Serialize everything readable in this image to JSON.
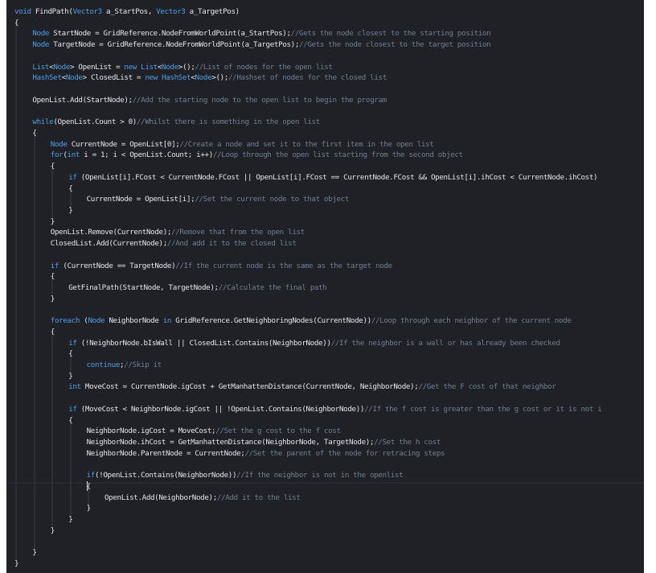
{
  "code": {
    "lines": [
      {
        "indent": 0,
        "tokens": [
          [
            "kw",
            "void"
          ],
          [
            "tx",
            " FindPath("
          ],
          [
            "ty",
            "Vector3"
          ],
          [
            "tx",
            " a_StartPos, "
          ],
          [
            "ty",
            "Vector3"
          ],
          [
            "tx",
            " a_TargetPos)"
          ]
        ]
      },
      {
        "indent": 0,
        "tokens": [
          [
            "tx",
            "{"
          ]
        ]
      },
      {
        "indent": 1,
        "tokens": [
          [
            "ty",
            "Node"
          ],
          [
            "tx",
            " StartNode = GridReference.NodeFromWorldPoint(a_StartPos);"
          ],
          [
            "cm",
            "//Gets the node closest to the starting position"
          ]
        ]
      },
      {
        "indent": 1,
        "tokens": [
          [
            "ty",
            "Node"
          ],
          [
            "tx",
            " TargetNode = GridReference.NodeFromWorldPoint(a_TargetPos);"
          ],
          [
            "cm",
            "//Gets the node closest to the target position"
          ]
        ]
      },
      {
        "indent": 0,
        "tokens": []
      },
      {
        "indent": 1,
        "tokens": [
          [
            "ty",
            "List"
          ],
          [
            "tx",
            "<"
          ],
          [
            "ty",
            "Node"
          ],
          [
            "tx",
            "> OpenList = "
          ],
          [
            "kw",
            "new"
          ],
          [
            "tx",
            " "
          ],
          [
            "ty",
            "List"
          ],
          [
            "tx",
            "<"
          ],
          [
            "ty",
            "Node"
          ],
          [
            "tx",
            ">();"
          ],
          [
            "cm",
            "//List of nodes for the open list"
          ]
        ]
      },
      {
        "indent": 1,
        "tokens": [
          [
            "ty",
            "HashSet"
          ],
          [
            "tx",
            "<"
          ],
          [
            "ty",
            "Node"
          ],
          [
            "tx",
            "> ClosedList = "
          ],
          [
            "kw",
            "new"
          ],
          [
            "tx",
            " "
          ],
          [
            "ty",
            "HashSet"
          ],
          [
            "tx",
            "<"
          ],
          [
            "ty",
            "Node"
          ],
          [
            "tx",
            ">();"
          ],
          [
            "cm",
            "//Hashset of nodes for the closed list"
          ]
        ]
      },
      {
        "indent": 0,
        "tokens": []
      },
      {
        "indent": 1,
        "tokens": [
          [
            "tx",
            "OpenList.Add(StartNode);"
          ],
          [
            "cm",
            "//Add the starting node to the open list to begin the program"
          ]
        ]
      },
      {
        "indent": 0,
        "tokens": []
      },
      {
        "indent": 1,
        "tokens": [
          [
            "kw",
            "while"
          ],
          [
            "tx",
            "(OpenList.Count > 0)"
          ],
          [
            "cm",
            "//Whilst there is something in the open list"
          ]
        ]
      },
      {
        "indent": 1,
        "tokens": [
          [
            "tx",
            "{"
          ]
        ]
      },
      {
        "indent": 2,
        "tokens": [
          [
            "ty",
            "Node"
          ],
          [
            "tx",
            " CurrentNode = OpenList[0];"
          ],
          [
            "cm",
            "//Create a node and set it to the first item in the open list"
          ]
        ]
      },
      {
        "indent": 2,
        "tokens": [
          [
            "kw",
            "for"
          ],
          [
            "tx",
            "("
          ],
          [
            "kw",
            "int"
          ],
          [
            "tx",
            " i = 1; i < OpenList.Count; i++)"
          ],
          [
            "cm",
            "//Loop through the open list starting from the second object"
          ]
        ]
      },
      {
        "indent": 2,
        "tokens": [
          [
            "tx",
            "{"
          ]
        ]
      },
      {
        "indent": 3,
        "tokens": [
          [
            "kw",
            "if"
          ],
          [
            "tx",
            " (OpenList[i].FCost < CurrentNode.FCost || OpenList[i].FCost == CurrentNode.FCost && OpenList[i].ihCost < CurrentNode.ihCost)"
          ]
        ]
      },
      {
        "indent": 3,
        "tokens": [
          [
            "tx",
            "{"
          ]
        ]
      },
      {
        "indent": 4,
        "tokens": [
          [
            "tx",
            "CurrentNode = OpenList[i];"
          ],
          [
            "cm",
            "//Set the current node to that object"
          ]
        ]
      },
      {
        "indent": 3,
        "tokens": [
          [
            "tx",
            "}"
          ]
        ]
      },
      {
        "indent": 2,
        "tokens": [
          [
            "tx",
            "}"
          ]
        ]
      },
      {
        "indent": 2,
        "tokens": [
          [
            "tx",
            "OpenList.Remove(CurrentNode);"
          ],
          [
            "cm",
            "//Remove that from the open list"
          ]
        ]
      },
      {
        "indent": 2,
        "tokens": [
          [
            "tx",
            "ClosedList.Add(CurrentNode);"
          ],
          [
            "cm",
            "//And add it to the closed list"
          ]
        ]
      },
      {
        "indent": 0,
        "tokens": []
      },
      {
        "indent": 2,
        "tokens": [
          [
            "kw",
            "if"
          ],
          [
            "tx",
            " (CurrentNode == TargetNode)"
          ],
          [
            "cm",
            "//If the current node is the same as the target node"
          ]
        ]
      },
      {
        "indent": 2,
        "tokens": [
          [
            "tx",
            "{"
          ]
        ]
      },
      {
        "indent": 3,
        "tokens": [
          [
            "tx",
            "GetFinalPath(StartNode, TargetNode);"
          ],
          [
            "cm",
            "//Calculate the final path"
          ]
        ]
      },
      {
        "indent": 2,
        "tokens": [
          [
            "tx",
            "}"
          ]
        ]
      },
      {
        "indent": 0,
        "tokens": []
      },
      {
        "indent": 2,
        "tokens": [
          [
            "kw",
            "foreach"
          ],
          [
            "tx",
            " ("
          ],
          [
            "ty",
            "Node"
          ],
          [
            "tx",
            " NeighborNode "
          ],
          [
            "kw",
            "in"
          ],
          [
            "tx",
            " GridReference.GetNeighboringNodes(CurrentNode))"
          ],
          [
            "cm",
            "//Loop through each neighbor of the current node"
          ]
        ]
      },
      {
        "indent": 2,
        "tokens": [
          [
            "tx",
            "{"
          ]
        ]
      },
      {
        "indent": 3,
        "tokens": [
          [
            "kw",
            "if"
          ],
          [
            "tx",
            " (!NeighborNode.bIsWall || ClosedList.Contains(NeighborNode))"
          ],
          [
            "cm",
            "//If the neighbor is a wall or has already been checked"
          ]
        ]
      },
      {
        "indent": 3,
        "tokens": [
          [
            "tx",
            "{"
          ]
        ]
      },
      {
        "indent": 4,
        "tokens": [
          [
            "kw",
            "continue"
          ],
          [
            "tx",
            ";"
          ],
          [
            "cm",
            "//Skip it"
          ]
        ]
      },
      {
        "indent": 3,
        "tokens": [
          [
            "tx",
            "}"
          ]
        ]
      },
      {
        "indent": 3,
        "tokens": [
          [
            "kw",
            "int"
          ],
          [
            "tx",
            " MoveCost = CurrentNode.igCost + GetManhattenDistance(CurrentNode, NeighborNode);"
          ],
          [
            "cm",
            "//Get the F cost of that neighbor"
          ]
        ]
      },
      {
        "indent": 0,
        "tokens": []
      },
      {
        "indent": 3,
        "tokens": [
          [
            "kw",
            "if"
          ],
          [
            "tx",
            " (MoveCost < NeighborNode.igCost || !OpenList.Contains(NeighborNode))"
          ],
          [
            "cm",
            "//If the f cost is greater than the g cost or it is not i"
          ]
        ]
      },
      {
        "indent": 3,
        "tokens": [
          [
            "tx",
            "{"
          ]
        ]
      },
      {
        "indent": 4,
        "tokens": [
          [
            "tx",
            "NeighborNode.igCost = MoveCost;"
          ],
          [
            "cm",
            "//Set the g cost to the f cost"
          ]
        ]
      },
      {
        "indent": 4,
        "tokens": [
          [
            "tx",
            "NeighborNode.ihCost = GetManhattenDistance(NeighborNode, TargetNode);"
          ],
          [
            "cm",
            "//Set the h cost"
          ]
        ]
      },
      {
        "indent": 4,
        "tokens": [
          [
            "tx",
            "NeighborNode.ParentNode = CurrentNode;"
          ],
          [
            "cm",
            "//Set the parent of the node for retracing steps"
          ]
        ]
      },
      {
        "indent": 0,
        "tokens": []
      },
      {
        "indent": 4,
        "tokens": [
          [
            "kw",
            "if"
          ],
          [
            "tx",
            "(!OpenList.Contains(NeighborNode))"
          ],
          [
            "cm",
            "//If the neighbor is not in the openlist"
          ]
        ]
      },
      {
        "indent": 4,
        "tokens": [
          [
            "tx",
            "{"
          ]
        ]
      },
      {
        "indent": 5,
        "tokens": [
          [
            "tx",
            "OpenList.Add(NeighborNode);"
          ],
          [
            "cm",
            "//Add it to the list"
          ]
        ]
      },
      {
        "indent": 4,
        "tokens": [
          [
            "tx",
            "}"
          ]
        ]
      },
      {
        "indent": 3,
        "tokens": [
          [
            "tx",
            "}"
          ]
        ]
      },
      {
        "indent": 2,
        "tokens": [
          [
            "tx",
            "}"
          ]
        ]
      },
      {
        "indent": 0,
        "tokens": []
      },
      {
        "indent": 1,
        "tokens": [
          [
            "tx",
            "}"
          ]
        ]
      },
      {
        "indent": 0,
        "tokens": [
          [
            "tx",
            "}"
          ]
        ]
      }
    ]
  },
  "colors": {
    "background": "#1f2127",
    "keyword": "#4f9fe6",
    "comment": "#6f7f95",
    "text": "#e2e6ec"
  }
}
